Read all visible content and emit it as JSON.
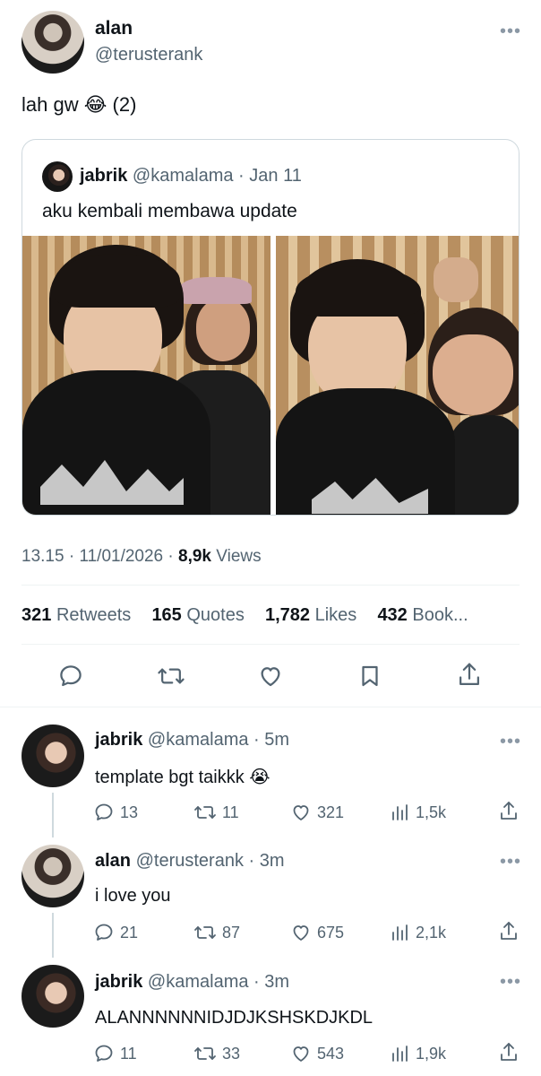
{
  "tweet": {
    "author_name": "alan",
    "author_handle": "@terusterank",
    "text": "lah gw 😂 (2)",
    "time": "13.15",
    "date": "11/01/2026",
    "views_count": "8,9k",
    "views_label": "Views",
    "retweets_count": "321",
    "retweets_label": "Retweets",
    "quotes_count": "165",
    "quotes_label": "Quotes",
    "likes_count": "1,782",
    "likes_label": "Likes",
    "bookmarks_count": "432",
    "bookmarks_label": "Book..."
  },
  "quoted": {
    "author_name": "jabrik",
    "author_handle": "@kamalama",
    "date": "· Jan 11",
    "text": "aku kembali membawa update"
  },
  "actions": {
    "reply_icon": "reply-icon",
    "retweet_icon": "retweet-icon",
    "like_icon": "heart-icon",
    "bookmark_icon": "bookmark-icon",
    "share_icon": "share-icon"
  },
  "replies": [
    {
      "author_name": "jabrik",
      "author_handle": "@kamalama",
      "time": "· 5m",
      "text": "template bgt taikkk 😭",
      "reply_count": "13",
      "retweet_count": "11",
      "like_count": "321",
      "view_count": "1,5k"
    },
    {
      "author_name": "alan",
      "author_handle": "@terusterank",
      "time": "· 3m",
      "text": "i love you",
      "reply_count": "21",
      "retweet_count": "87",
      "like_count": "675",
      "view_count": "2,1k"
    },
    {
      "author_name": "jabrik",
      "author_handle": "@kamalama",
      "time": "· 3m",
      "text": "ALANNNNNNIDJDJKSHSKDJKDL",
      "reply_count": "11",
      "retweet_count": "33",
      "like_count": "543",
      "view_count": "1,9k"
    }
  ],
  "colors": {
    "text": "#0f1419",
    "muted": "#536471",
    "border": "#cfd9de",
    "divider": "#eff3f4"
  }
}
